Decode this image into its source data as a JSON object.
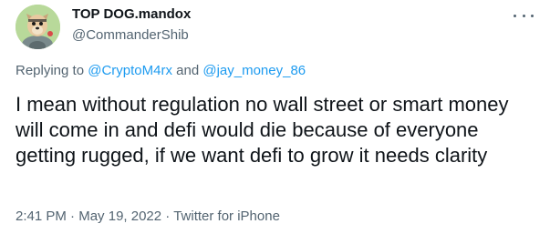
{
  "author": {
    "display_name": "TOP DOG.mandox",
    "handle": "@CommanderShib",
    "avatar_icon": "shiba-dog-avatar-icon"
  },
  "menu": {
    "more_icon": "more-horizontal-icon"
  },
  "reply": {
    "prefix": "Replying to",
    "mention_1": "@CryptoM4rx",
    "conjunction": "and",
    "mention_2": "@jay_money_86"
  },
  "tweet": {
    "text": "I mean without regulation no wall street or smart money will come in and defi would die because of everyone getting rugged, if we want defi to grow it needs clarity"
  },
  "meta": {
    "time": "2:41 PM",
    "separator_1": "·",
    "date": "May 19, 2022",
    "separator_2": "·",
    "source": "Twitter for iPhone"
  },
  "colors": {
    "text_primary": "#0f1419",
    "text_secondary": "#536471",
    "link_blue": "#1d9bf0",
    "avatar_bg": "#b8d99a"
  }
}
